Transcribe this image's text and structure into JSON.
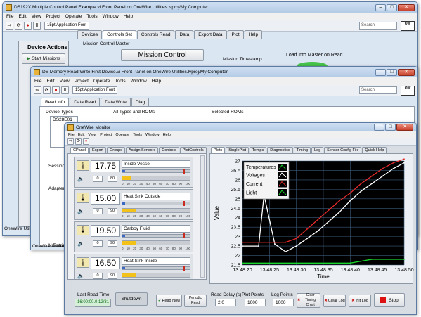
{
  "win1": {
    "title": "DS192X Multiple Control Panel Example.vi Front Panel on OneWire Utilities.lvproj/My Computer",
    "menu": [
      "File",
      "Edit",
      "View",
      "Project",
      "Operate",
      "Tools",
      "Window",
      "Help"
    ],
    "font": "15pt Application Font",
    "search": "Search",
    "tabs": [
      "Devices",
      "Controls Set",
      "Controls Read",
      "Data",
      "Export Data",
      "Plot",
      "Help"
    ],
    "device_actions": "Device Actions",
    "start_missions": "Start Missions",
    "mission_control_master": "Mission Control Master",
    "mission_control": "Mission Control",
    "mission_timestamp": "Mission Timestamp",
    "load_into_master": "Load into Master on Read",
    "session_label": "Session",
    "adapter_label": "Adapter",
    "idle": "Idle",
    "retries": "N Retries",
    "status": "OneWire Utilities..."
  },
  "win2": {
    "title": "DS Memory Read Write First Device.vi Front Panel on OneWire Utilities.lvproj/My Computer",
    "menu": [
      "File",
      "Edit",
      "View",
      "Project",
      "Operate",
      "Tools",
      "Window",
      "Help"
    ],
    "font": "15pt Application Font",
    "search": "Search",
    "tabs": [
      "Read Info",
      "Data Read",
      "Data Write",
      "Diag"
    ],
    "device_types": "Device Types",
    "device_type_item": "DS28E01",
    "all_types": "All Types and ROMs",
    "selected_roms": "Selected ROMs",
    "status": "OneWire Utilities..."
  },
  "win3": {
    "title": "OneWire Monitor",
    "menu": [
      "File",
      "Edit",
      "View",
      "Project",
      "Operate",
      "Tools",
      "Window",
      "Help"
    ],
    "left_tabs": [
      "CPanel",
      "Export",
      "Groups",
      "Assign Sensors",
      "Controls",
      "PlotControls"
    ],
    "right_tabs": [
      "Plots",
      "SinglePlot",
      "Temps",
      "Diagnostics",
      "Timing",
      "Log",
      "Sensor Config File",
      "Quick Help"
    ],
    "modules": [
      {
        "value": "17.75",
        "name": "Inside Vessel",
        "fill": 0.04,
        "mark": 0.9,
        "a": "0",
        "b": "80",
        "slider": 0.0
      },
      {
        "value": "15.00",
        "name": "Heat Sink Outside",
        "fill": 0.04,
        "mark": 0.9,
        "a": "0",
        "b": "90",
        "slider": 0.2
      },
      {
        "value": "19.50",
        "name": "Carboy Fluid",
        "fill": 0.04,
        "mark": 0.9,
        "a": "0",
        "b": "90",
        "slider": 0.2
      },
      {
        "value": "16.50",
        "name": "Heat Sink Inside",
        "fill": 0.04,
        "mark": 0.9,
        "a": "0",
        "b": "90",
        "slider": 0.2
      }
    ],
    "scale_ticks": [
      "0",
      "10",
      "20",
      "30",
      "40",
      "50",
      "60",
      "70",
      "80",
      "90",
      "100"
    ],
    "bottom": {
      "last_read_time": "Last Read Time",
      "time_value": "16:00:00.0 12/31",
      "shutdown": "Shutdown",
      "read_now": "Read Now",
      "periodic_read": "Periodic Read",
      "read_delay_label": "Read Delay (s)",
      "read_delay": "2.0",
      "plot_points_label": "Plot Points",
      "plot_points": "1000",
      "log_points_label": "Log Points",
      "log_points": "1000",
      "clear_timing": "Clear Timing Chart",
      "clear_log": "Clear Log",
      "init_log": "Init Log",
      "stop": "Stop"
    }
  },
  "chart_data": {
    "type": "line",
    "xlabel": "Time",
    "ylabel": "Value",
    "x_ticks": [
      "13:48:20",
      "13:48:25",
      "13:48:30",
      "13:48:35",
      "13:48:40",
      "13:48:45",
      "13:48:50"
    ],
    "y_ticks": [
      "21.5",
      "22",
      "22.5",
      "23",
      "23.5",
      "24",
      "24.5",
      "25",
      "25.5",
      "26",
      "26.5",
      "27"
    ],
    "ylim": [
      21.5,
      27
    ],
    "xlim": [
      0,
      30
    ],
    "legend_title": "Temperatures",
    "series": [
      {
        "name": "Voltages",
        "color": "#ffffff",
        "x": [
          0,
          3,
          4,
          6,
          8,
          10,
          12,
          14,
          16,
          18,
          20,
          22,
          24,
          26,
          28,
          30
        ],
        "y": [
          22.5,
          22.5,
          25.2,
          22.6,
          22.2,
          22.5,
          22.9,
          23.3,
          23.8,
          24.3,
          24.9,
          25.4,
          25.8,
          26.2,
          26.6,
          26.9
        ]
      },
      {
        "name": "Current",
        "color": "#e52b2b",
        "x": [
          0,
          4,
          6,
          8,
          10,
          12,
          14,
          16,
          18,
          20,
          22,
          24,
          26,
          28,
          30
        ],
        "y": [
          22.7,
          22.7,
          22.7,
          22.7,
          22.9,
          23.4,
          23.9,
          24.4,
          24.9,
          25.3,
          25.8,
          26.2,
          26.6,
          26.9,
          27.1
        ]
      },
      {
        "name": "Light",
        "color": "#19d42a",
        "x": [
          0,
          20,
          24,
          30
        ],
        "y": [
          21.6,
          21.6,
          21.8,
          21.8
        ]
      }
    ],
    "grid": true,
    "legend_position": "top-left"
  }
}
